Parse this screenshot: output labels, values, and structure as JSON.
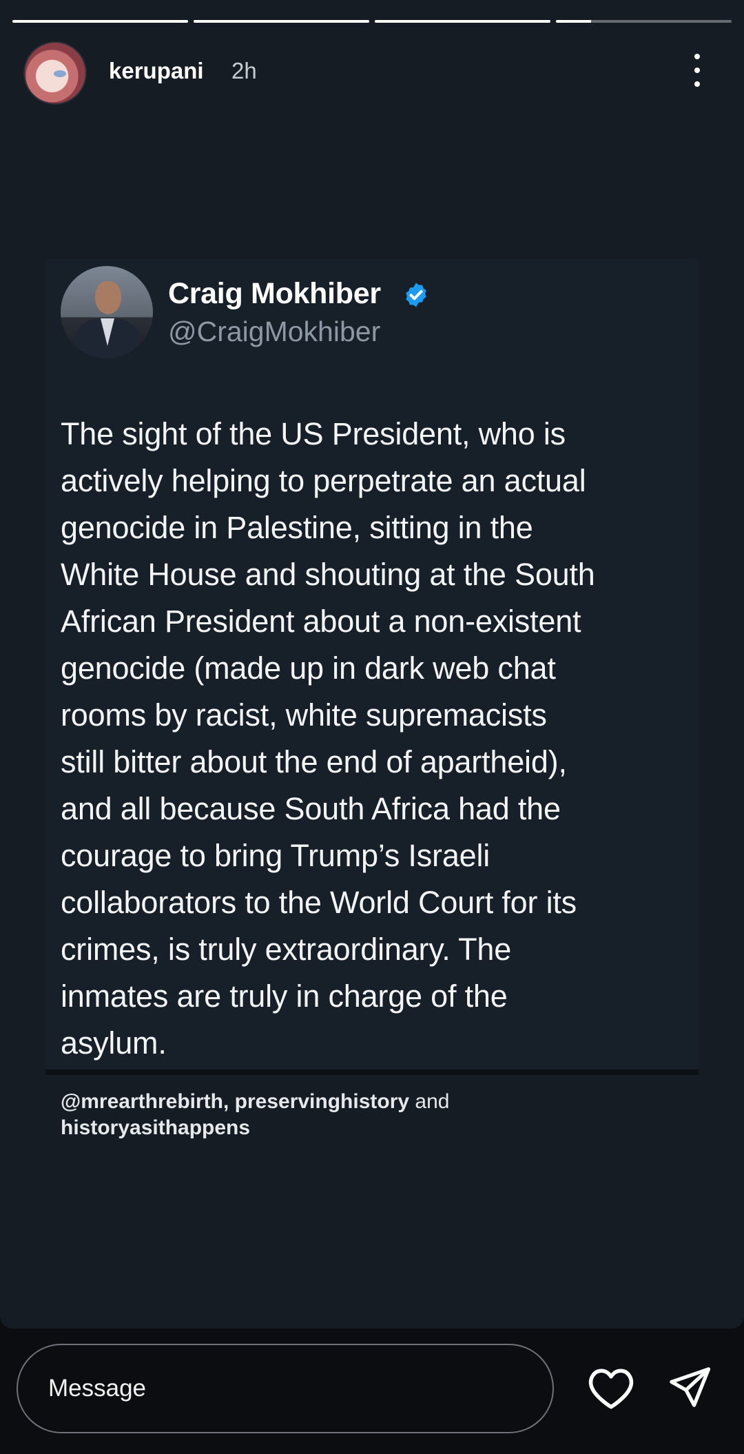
{
  "story": {
    "progress": [
      1,
      1,
      1,
      0.2
    ],
    "user": {
      "username": "kerupani",
      "time": "2h"
    },
    "tweet": {
      "name": "Craig Mokhiber",
      "handle": "@CraigMokhiber",
      "lines": [
        "The sight of the US President, who is",
        "actively helping to perpetrate an actual",
        "genocide in Palestine,  sitting in the",
        "White House and shouting at the South",
        "African President about a non-existent",
        "genocide (made up in dark web chat",
        "rooms by racist, white supremacists",
        "still bitter about the end of apartheid),",
        "and all because South Africa had the",
        "courage to bring Trump’s Israeli",
        "collaborators to the World Court for its",
        "crimes, is truly extraordinary. The",
        "inmates are truly in charge of the",
        "asylum."
      ]
    },
    "mentions": {
      "first": "@mrearthrebirth, preservinghistory",
      "connector": " and",
      "last": "historyasithappens"
    }
  },
  "footer": {
    "message_placeholder": "Message"
  },
  "icons": {
    "more": "more-vertical-icon",
    "verified": "verified-badge-icon",
    "like": "heart-icon",
    "share": "send-icon"
  },
  "colors": {
    "background": "#161c24",
    "card": "#172029",
    "verified": "#1d9bf0"
  }
}
